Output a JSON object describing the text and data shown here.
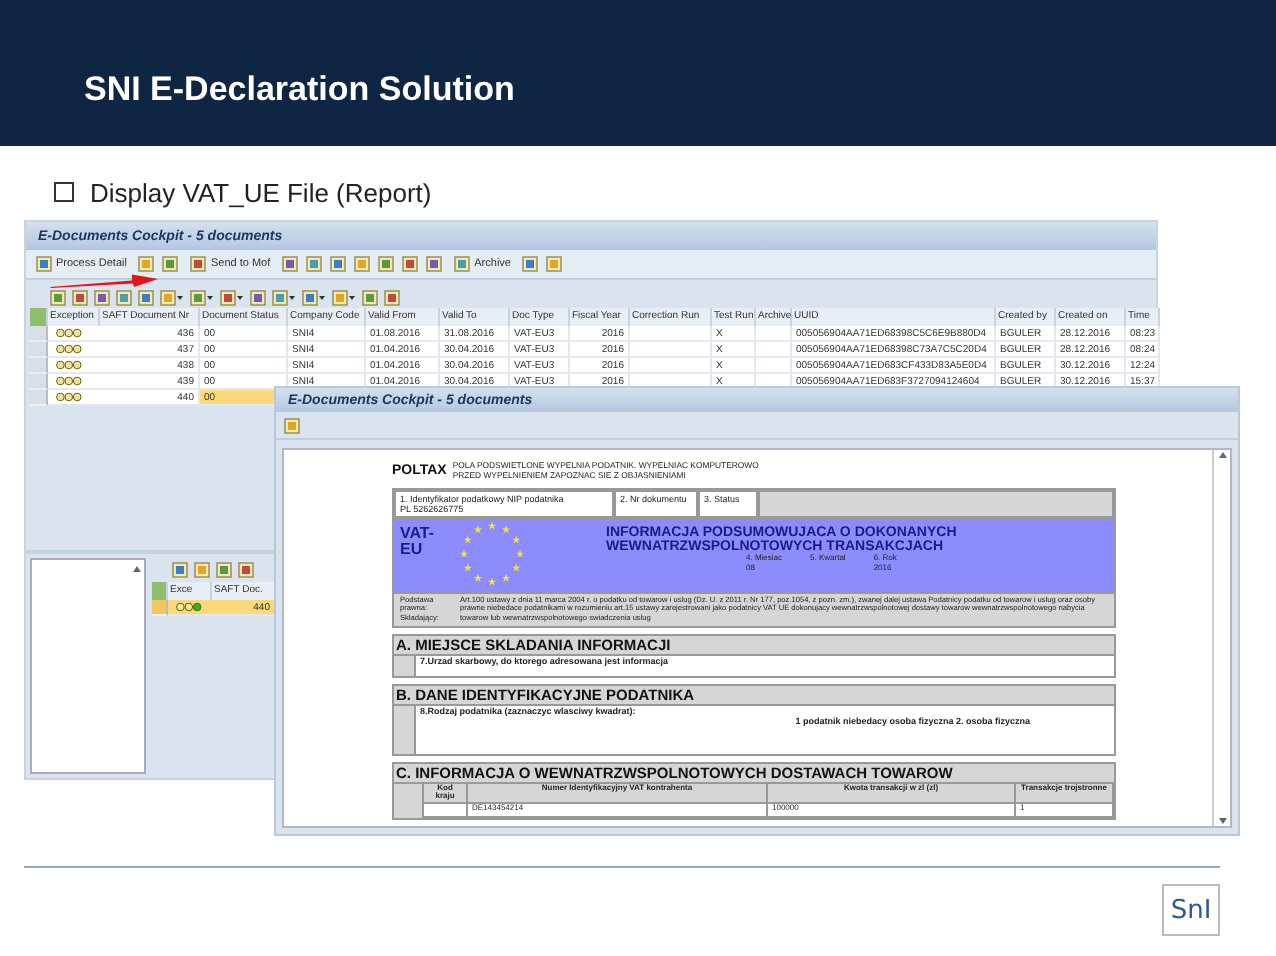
{
  "slide": {
    "title": "SNI E-Declaration Solution",
    "bullet": "Display VAT_UE File (Report)",
    "logo": "SnI"
  },
  "cockpit": {
    "title": "E-Documents Cockpit - 5 documents",
    "toolbar": [
      {
        "kind": "button",
        "label": "Process Detail"
      },
      {
        "kind": "icon"
      },
      {
        "kind": "icon"
      },
      {
        "kind": "button",
        "label": "Send to Mof"
      },
      {
        "kind": "icon"
      },
      {
        "kind": "icon"
      },
      {
        "kind": "icon"
      },
      {
        "kind": "icon"
      },
      {
        "kind": "icon"
      },
      {
        "kind": "icon"
      },
      {
        "kind": "icon"
      },
      {
        "kind": "button",
        "label": "Archive"
      },
      {
        "kind": "icon"
      },
      {
        "kind": "icon"
      }
    ],
    "alv_toolbar": [
      {
        "kind": "icon"
      },
      {
        "kind": "icon"
      },
      {
        "kind": "icon"
      },
      {
        "kind": "icon"
      },
      {
        "kind": "icon"
      },
      {
        "kind": "dropdown"
      },
      {
        "kind": "dropdown"
      },
      {
        "kind": "dropdown"
      },
      {
        "kind": "icon"
      },
      {
        "kind": "dropdown"
      },
      {
        "kind": "dropdown"
      },
      {
        "kind": "dropdown"
      },
      {
        "kind": "icon"
      },
      {
        "kind": "icon"
      }
    ],
    "columns": [
      "Exception",
      "SAFT Document Nr",
      "Document Status",
      "Company Code",
      "Valid From",
      "Valid To",
      "Doc Type",
      "Fiscal Year",
      "Correction Run",
      "Test Run",
      "Archive",
      "UUID",
      "Created by",
      "Created on",
      "Time"
    ],
    "rows": [
      {
        "lit": false,
        "selected": false,
        "cells": [
          "",
          "436",
          "00",
          "SNI4",
          "01.08.2016",
          "31.08.2016",
          "VAT-EU3",
          "2016",
          "",
          "X",
          "",
          "005056904AA71ED68398C5C6E9B880D4",
          "BGULER",
          "28.12.2016",
          "08:23"
        ]
      },
      {
        "lit": false,
        "selected": false,
        "cells": [
          "",
          "437",
          "00",
          "SNI4",
          "01.04.2016",
          "30.04.2016",
          "VAT-EU3",
          "2016",
          "",
          "X",
          "",
          "005056904AA71ED68398C73A7C5C20D4",
          "BGULER",
          "28.12.2016",
          "08:24"
        ]
      },
      {
        "lit": false,
        "selected": false,
        "cells": [
          "",
          "438",
          "00",
          "SNI4",
          "01.04.2016",
          "30.04.2016",
          "VAT-EU3",
          "2016",
          "",
          "X",
          "",
          "005056904AA71ED683CF433D83A5E0D4",
          "BGULER",
          "30.12.2016",
          "12:24"
        ]
      },
      {
        "lit": false,
        "selected": false,
        "cells": [
          "",
          "439",
          "00",
          "SNI4",
          "01.04.2016",
          "30.04.2016",
          "VAT-EU3",
          "2016",
          "",
          "X",
          "",
          "005056904AA71ED683F3727094124604",
          "BGULER",
          "30.12.2016",
          "15:37"
        ]
      },
      {
        "lit": false,
        "selected": true,
        "cells": [
          "",
          "440",
          "00"
        ]
      }
    ],
    "detail": {
      "columns": [
        "Exce",
        "SAFT Doc."
      ],
      "rows": [
        {
          "lit": true,
          "selected": true,
          "number": "440"
        }
      ]
    }
  },
  "report": {
    "title": "E-Documents Cockpit - 5 documents",
    "form": {
      "brand": "POLTAX",
      "notice": [
        "POLA PODSWIETLONE WYPELNIA PODATNIK. WYPELNIAC KOMPUTEROWO",
        "PRZED WYPELNIENIEM ZAPOZNAC SIE Z OBJASNIENIAMI"
      ],
      "id_fields": [
        {
          "label": "1. Identyfikator podatkowy NIP podatnika",
          "value": "PL 5262626775"
        },
        {
          "label": "2. Nr dokumentu"
        },
        {
          "label": "3. Status"
        }
      ],
      "form_code": "VAT-EU",
      "heading": [
        "INFORMACJA PODSUMOWUJACA O DOKONANYCH",
        "WEWNATRZWSPOLNOTOWYCH TRANSAKCJACH"
      ],
      "period": [
        {
          "label": "4. Miesiac",
          "value": "08"
        },
        {
          "label": "5. Kwartal"
        },
        {
          "label": "6. Rok",
          "value": "2016"
        }
      ],
      "legal_labels": "Podstawa prawna: Składający:",
      "legal_text": "Art.100 ustawy z dnia 11 marca 2004 r. o podatku od towarow i uslug (Dz. U. z 2011 r. Nr 177, poz.1054, z pozn. zm.), zwanej dalej ustawa Podatnicy podatku od towarow i uslug oraz osoby prawne niebedace podatnikami w rozumieniu art.15 ustawy zarejestrowani jako podatnicy VAT UE dokonujacy wewnatrzwspolnotowej dostawy towarow wewnatrzwspolnotowego nabycia towarow lub wewnatrzwspolnotowego swiadczenia uslug",
      "section_a": {
        "title": "A. MIEJSCE SKLADANIA INFORMACJI",
        "field": "7.Urzad skarbowy, do ktorego adresowana jest informacja"
      },
      "section_b": {
        "title": "B. DANE IDENTYFIKACYJNE PODATNIKA",
        "field": "8.Rodzaj podatnika (zaznaczyc wlasciwy kwadrat):",
        "options": "1 podatnik niebedacy osoba fizyczna 2. osoba fizyczna"
      },
      "section_c": {
        "title": "C. INFORMACJA O WEWNATRZWSPOLNOTOWYCH DOSTAWACH TOWAROW",
        "columns": [
          "Kod kraju",
          "Numer Identyfikacyjny VAT kontrahenta",
          "Kwota transakcji w zl (zl)",
          "Transakcje trojstronne"
        ],
        "rows": [
          [
            "",
            "DE143454214",
            "100000",
            "1"
          ]
        ]
      }
    }
  }
}
